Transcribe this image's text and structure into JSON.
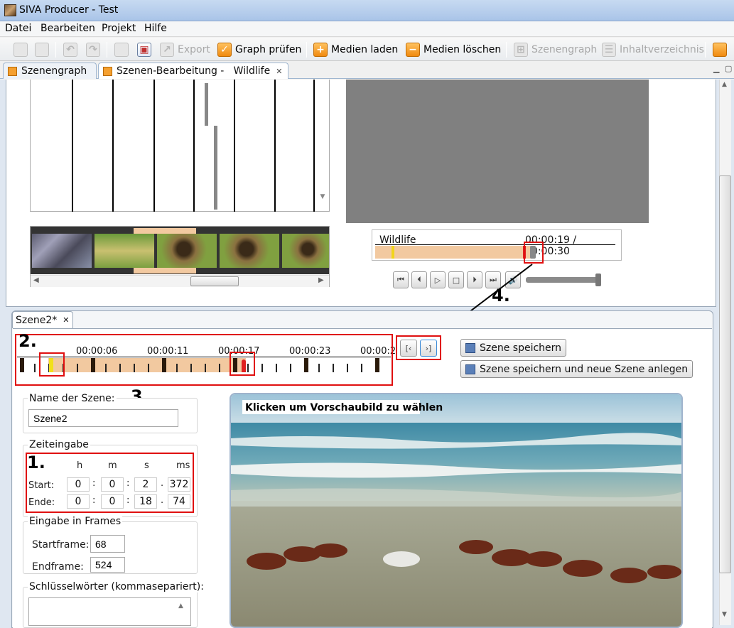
{
  "window": {
    "title": "SIVA Producer - Test"
  },
  "menu": [
    "Datei",
    "Bearbeiten",
    "Projekt",
    "Hilfe"
  ],
  "toolbar": {
    "export": "Export",
    "graph_check": "Graph prüfen",
    "load_media": "Medien laden",
    "delete_media": "Medien löschen",
    "scene_graph": "Szenengraph",
    "toc": "Inhaltverzeichnis"
  },
  "tabs": {
    "scene_graph": "Szenengraph",
    "scene_edit": "Szenen-Bearbeitung -   Wildlife"
  },
  "player": {
    "media_name": "Wildlife",
    "time": "00:00:19 / 00:00:30"
  },
  "scene_tab": {
    "label": "Szene2*"
  },
  "timeline": {
    "labels": [
      "00:00:06",
      "00:00:11",
      "00:00:17",
      "00:00:23",
      "00:00:2"
    ]
  },
  "buttons": {
    "save_scene": "Szene speichern",
    "save_and_new": "Szene speichern und neue Szene anlegen"
  },
  "annotations": {
    "one": "1.",
    "two": "2.",
    "three": "3.",
    "four": "4."
  },
  "scene_name": {
    "label": "Name der Szene:",
    "value": "Szene2"
  },
  "time_input": {
    "label": "Zeiteingabe",
    "headers": [
      "h",
      "m",
      "s",
      "ms"
    ],
    "start_label": "Start:",
    "end_label": "Ende:",
    "start": [
      "0",
      "0",
      "2",
      "372"
    ],
    "end": [
      "0",
      "0",
      "18",
      "74"
    ]
  },
  "frames": {
    "label": "Eingabe in Frames",
    "start_label": "Startframe:",
    "start_value": "68",
    "end_label": "Endframe:",
    "end_value": "524"
  },
  "keywords": {
    "label": "Schlüsselwörter (kommasepariert):"
  },
  "preview": {
    "caption": "Klicken um Vorschaubild zu wählen"
  }
}
